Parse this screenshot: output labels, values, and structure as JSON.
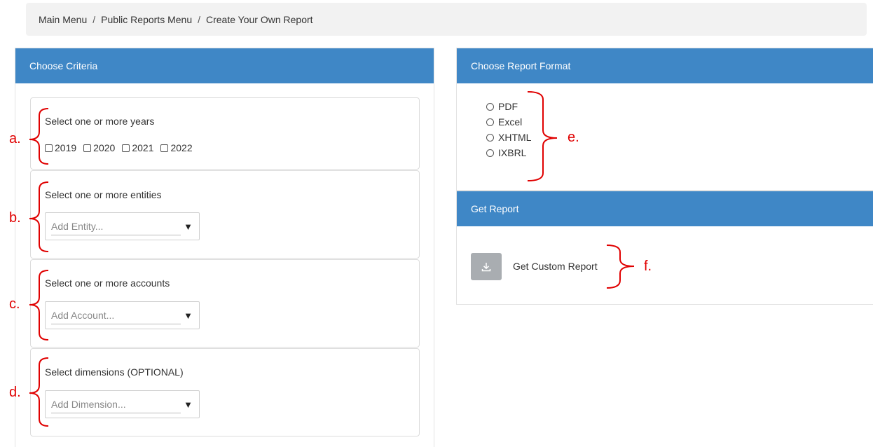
{
  "breadcrumb": {
    "items": [
      "Main Menu",
      "Public Reports Menu",
      "Create Your Own Report"
    ],
    "separator": "/"
  },
  "criteria": {
    "header": "Choose Criteria",
    "years": {
      "title": "Select one or more years",
      "options": [
        "2019",
        "2020",
        "2021",
        "2022"
      ]
    },
    "entities": {
      "title": "Select one or more entities",
      "placeholder": "Add Entity..."
    },
    "accounts": {
      "title": "Select one or more accounts",
      "placeholder": "Add Account..."
    },
    "dimensions": {
      "title": "Select dimensions (OPTIONAL)",
      "placeholder": "Add Dimension..."
    }
  },
  "format": {
    "header": "Choose Report Format",
    "options": [
      "PDF",
      "Excel",
      "XHTML",
      "IXBRL"
    ]
  },
  "report": {
    "header": "Get Report",
    "button_label": "Get Custom Report",
    "icon": "download-icon"
  },
  "annotations": {
    "a": "a.",
    "b": "b.",
    "c": "c.",
    "d": "d.",
    "e": "e.",
    "f": "f."
  },
  "colors": {
    "header_bg": "#3f87c6",
    "annotation": "#e00000",
    "button_bg": "#a9adb1"
  }
}
